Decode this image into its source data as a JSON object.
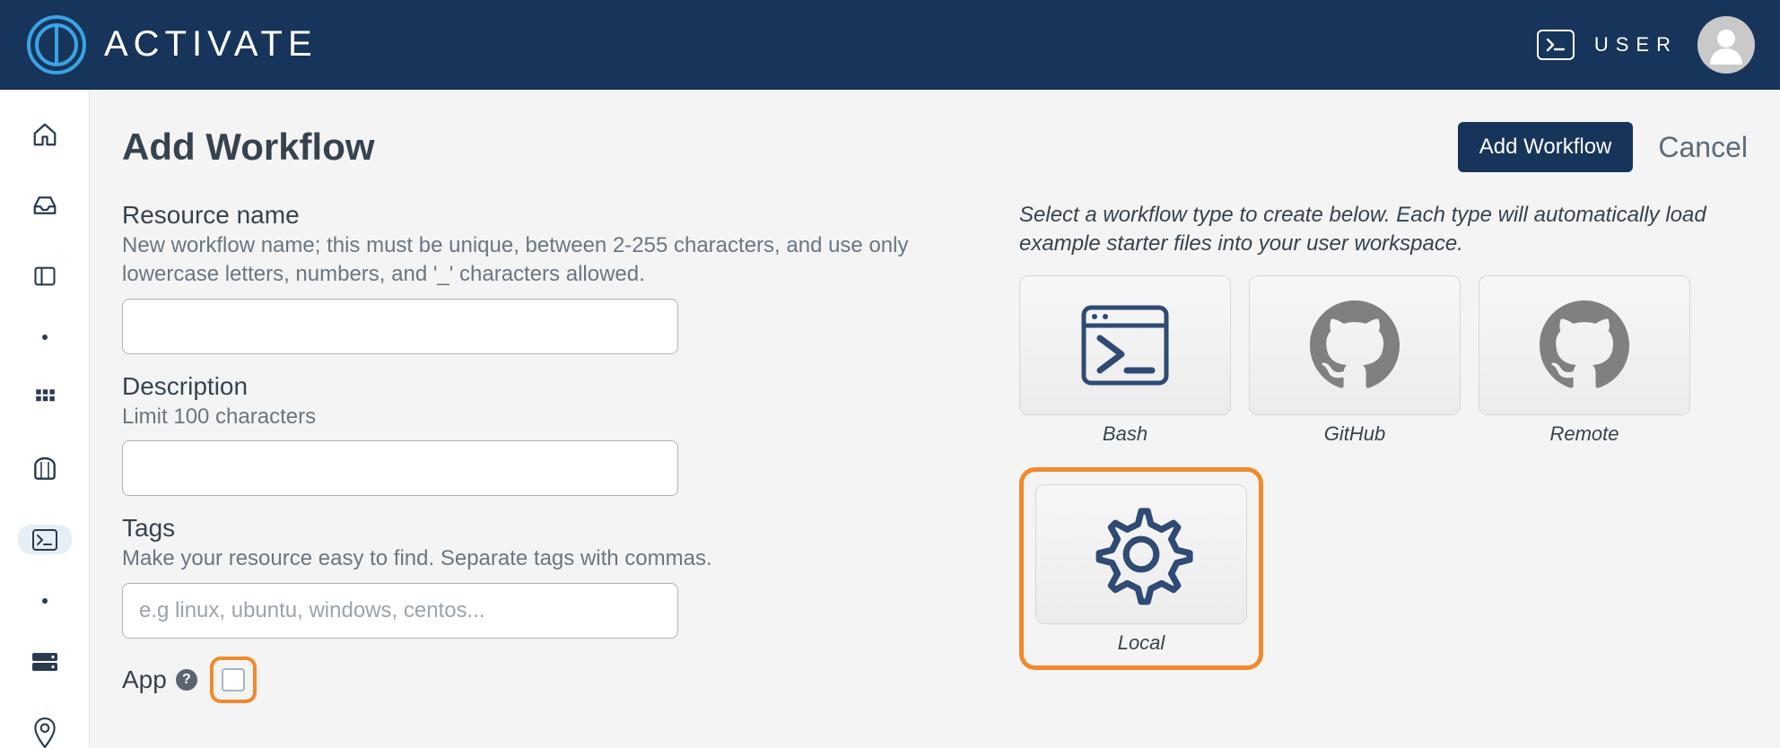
{
  "brand": {
    "name": "ACTIVATE"
  },
  "topbar": {
    "user_label": "USER"
  },
  "page": {
    "title": "Add Workflow",
    "add_button": "Add Workflow",
    "cancel_button": "Cancel"
  },
  "form": {
    "resource_name": {
      "label": "Resource name",
      "help": "New workflow name; this must be unique, between 2-255 characters, and use only lowercase letters, numbers, and '_' characters allowed.",
      "value": ""
    },
    "description": {
      "label": "Description",
      "help": "Limit 100 characters",
      "value": ""
    },
    "tags": {
      "label": "Tags",
      "help": "Make your resource easy to find. Separate tags with commas.",
      "placeholder": "e.g linux, ubuntu, windows, centos...",
      "value": ""
    },
    "app": {
      "label": "App",
      "checked": false
    }
  },
  "types": {
    "instruction": "Select a workflow type to create below. Each type will automatically load example starter files into your user workspace.",
    "items": [
      {
        "key": "bash",
        "label": "Bash",
        "selected": false
      },
      {
        "key": "github",
        "label": "GitHub",
        "selected": false
      },
      {
        "key": "remote",
        "label": "Remote",
        "selected": false
      },
      {
        "key": "local",
        "label": "Local",
        "selected": true
      }
    ]
  },
  "colors": {
    "navy": "#17355a",
    "orange": "#f08a2c",
    "icon_gray": "#808080",
    "icon_navy": "#2f4a74"
  }
}
